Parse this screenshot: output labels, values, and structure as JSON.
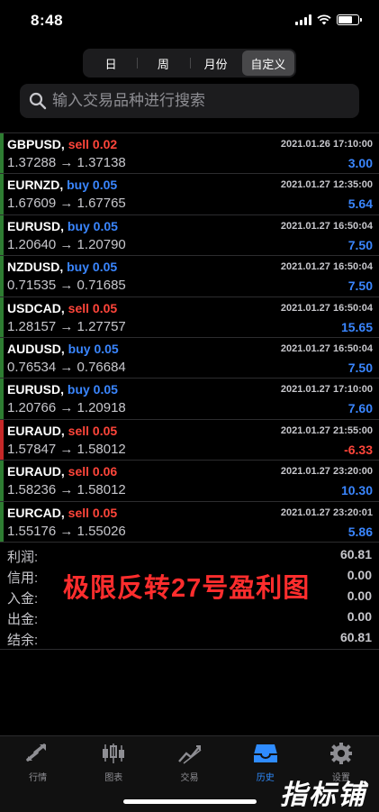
{
  "status": {
    "time": "8:48"
  },
  "period_tabs": [
    {
      "label": "日",
      "active": false
    },
    {
      "label": "周",
      "active": false
    },
    {
      "label": "月份",
      "active": false
    },
    {
      "label": "自定义",
      "active": true
    }
  ],
  "search": {
    "placeholder": "输入交易品种进行搜索"
  },
  "trades": [
    {
      "symbol": "GBPUSD,",
      "side": "sell 0.02",
      "side_color": "#ff453a",
      "bar_color": "#2e7d32",
      "prices": "1.37288 → 1.37138",
      "time": "2021.01.26 17:10:00",
      "profit": "3.00",
      "profit_color": "#3a86ff"
    },
    {
      "symbol": "EURNZD,",
      "side": "buy 0.05",
      "side_color": "#3a86ff",
      "bar_color": "#2e7d32",
      "prices": "1.67609 → 1.67765",
      "time": "2021.01.27 12:35:00",
      "profit": "5.64",
      "profit_color": "#3a86ff"
    },
    {
      "symbol": "EURUSD,",
      "side": "buy 0.05",
      "side_color": "#3a86ff",
      "bar_color": "#2e7d32",
      "prices": "1.20640 → 1.20790",
      "time": "2021.01.27 16:50:04",
      "profit": "7.50",
      "profit_color": "#3a86ff"
    },
    {
      "symbol": "NZDUSD,",
      "side": "buy 0.05",
      "side_color": "#3a86ff",
      "bar_color": "#2e7d32",
      "prices": "0.71535 → 0.71685",
      "time": "2021.01.27 16:50:04",
      "profit": "7.50",
      "profit_color": "#3a86ff"
    },
    {
      "symbol": "USDCAD,",
      "side": "sell 0.05",
      "side_color": "#ff453a",
      "bar_color": "#2e7d32",
      "prices": "1.28157 → 1.27757",
      "time": "2021.01.27 16:50:04",
      "profit": "15.65",
      "profit_color": "#3a86ff"
    },
    {
      "symbol": "AUDUSD,",
      "side": "buy 0.05",
      "side_color": "#3a86ff",
      "bar_color": "#2e7d32",
      "prices": "0.76534 → 0.76684",
      "time": "2021.01.27 16:50:04",
      "profit": "7.50",
      "profit_color": "#3a86ff"
    },
    {
      "symbol": "EURUSD,",
      "side": "buy 0.05",
      "side_color": "#3a86ff",
      "bar_color": "#2e7d32",
      "prices": "1.20766 → 1.20918",
      "time": "2021.01.27 17:10:00",
      "profit": "7.60",
      "profit_color": "#3a86ff"
    },
    {
      "symbol": "EURAUD,",
      "side": "sell 0.05",
      "side_color": "#ff453a",
      "bar_color": "#c62828",
      "prices": "1.57847 → 1.58012",
      "time": "2021.01.27 21:55:00",
      "profit": "-6.33",
      "profit_color": "#ff453a"
    },
    {
      "symbol": "EURAUD,",
      "side": "sell 0.06",
      "side_color": "#ff453a",
      "bar_color": "#2e7d32",
      "prices": "1.58236 → 1.58012",
      "time": "2021.01.27 23:20:00",
      "profit": "10.30",
      "profit_color": "#3a86ff"
    },
    {
      "symbol": "EURCAD,",
      "side": "sell 0.05",
      "side_color": "#ff453a",
      "bar_color": "#2e7d32",
      "prices": "1.55176 → 1.55026",
      "time": "2021.01.27 23:20:01",
      "profit": "5.86",
      "profit_color": "#3a86ff"
    }
  ],
  "summary": [
    {
      "label": "利润:",
      "value": "60.81"
    },
    {
      "label": "信用:",
      "value": "0.00"
    },
    {
      "label": "入金:",
      "value": "0.00"
    },
    {
      "label": "出金:",
      "value": "0.00"
    },
    {
      "label": "结余:",
      "value": "60.81"
    }
  ],
  "overlay_text": "极限反转27号盈利图",
  "tabbar": [
    {
      "label": "行情",
      "icon": "quotes-icon",
      "active": false
    },
    {
      "label": "图表",
      "icon": "chart-icon",
      "active": false
    },
    {
      "label": "交易",
      "icon": "trade-icon",
      "active": false
    },
    {
      "label": "历史",
      "icon": "history-icon",
      "active": true
    },
    {
      "label": "设置",
      "icon": "settings-icon",
      "active": false
    }
  ],
  "watermark": "指标铺",
  "colors": {
    "accent": "#2f8cff",
    "buy": "#3a86ff",
    "sell": "#ff453a"
  }
}
